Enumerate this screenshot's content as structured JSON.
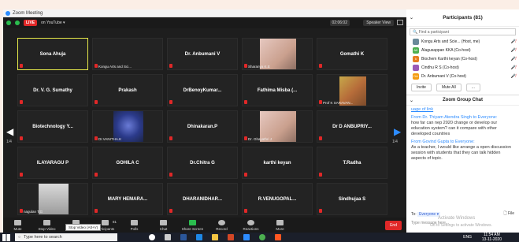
{
  "window": {
    "title": "Zoom Meeting",
    "controls": [
      "–",
      "□",
      "✕"
    ]
  },
  "topbar": {
    "live_label": "LIVE",
    "youtube_label": "on YouTube ▾",
    "timer": "02:06:02",
    "speaker_view": "Speaker View"
  },
  "tiles": [
    {
      "name": "Sona Ahuja",
      "sub": "",
      "active": true
    },
    {
      "name": "",
      "sub": "Kongu Arts and Sci..."
    },
    {
      "name": "Dr. Anbumani V",
      "sub": ""
    },
    {
      "name": "",
      "sub": "Sharanya K.E"
    },
    {
      "name": "Gomathi K",
      "sub": ""
    },
    {
      "name": "Dr. V. G. Sumathy",
      "sub": ""
    },
    {
      "name": "Prakash",
      "sub": ""
    },
    {
      "name": "DrBenoyKumar...",
      "sub": ""
    },
    {
      "name": "Fathima Misba (...",
      "sub": ""
    },
    {
      "name": "",
      "sub": "Prof K SARAVAN..."
    },
    {
      "name": "Biotechnology Y...",
      "sub": ""
    },
    {
      "name": "",
      "sub": "Dr.VANITHA.K"
    },
    {
      "name": "Dhinakaran.P",
      "sub": ""
    },
    {
      "name": "",
      "sub": "Dr. Ghayathri J"
    },
    {
      "name": "Dr D ANBUPRIY...",
      "sub": ""
    },
    {
      "name": "ILAYARAGU P",
      "sub": ""
    },
    {
      "name": "GOHILA C",
      "sub": ""
    },
    {
      "name": "Dr.Chitra G",
      "sub": ""
    },
    {
      "name": "karthi keyan",
      "sub": ""
    },
    {
      "name": "T.Radha",
      "sub": ""
    },
    {
      "name": "",
      "sub": "nagulan T.G"
    },
    {
      "name": "MARY HEMARA...",
      "sub": ""
    },
    {
      "name": "DHARANIDHAR...",
      "sub": ""
    },
    {
      "name": "R.VENUGOPAL...",
      "sub": ""
    },
    {
      "name": "Sindhujaa S",
      "sub": ""
    }
  ],
  "pager": {
    "left": "1/4",
    "right": "1/4"
  },
  "toolbar": {
    "items": [
      "Mute",
      "Stop Video",
      "Security",
      "Participants",
      "Polls",
      "Chat",
      "Share Screen",
      "Record",
      "Reactions",
      "More"
    ],
    "participants_count": "81",
    "end_label": "End",
    "tooltip": "Stop Video (Alt+V)"
  },
  "participants": {
    "title": "Participants (81)",
    "search_placeholder": "Find a participant",
    "list": [
      {
        "initials": "",
        "name": "Kongu Arts and Scie... (Host, me)",
        "color": "#6a8a9a"
      },
      {
        "initials": "AK",
        "name": "Alagusappan KKA (Co-host)",
        "color": "#4caf50"
      },
      {
        "initials": "k",
        "name": "Biochem Karthi keyan (Co-host)",
        "color": "#e67e22"
      },
      {
        "initials": "",
        "name": "Cindhu R S (Co-host)",
        "color": "#9b59b6"
      },
      {
        "initials": "DA",
        "name": "Dr. Anbumani V (Co-host)",
        "color": "#f39c12"
      }
    ],
    "invite": "Invite",
    "mute_all": "Mute All",
    "more": "..."
  },
  "chat": {
    "title": "Zoom Group Chat",
    "link_text": "uage of link",
    "messages": [
      {
        "from": "From Dr. Thiyam Atendra Singh to Everyone:",
        "text": "how far can nep 2020 change or develop our education system? can it compare with other developed countries"
      },
      {
        "from": "From Govind Gupta to Everyone:",
        "text": "As a teacher, I would like arrange a open discussion session with students that they can talk hidden aspects of topic."
      }
    ],
    "to_label": "To:",
    "to_value": "Everyone ▾",
    "file_label": "File",
    "type_placeholder": "Type message here...",
    "watermark": "Activate Windows",
    "watermark2": "Go to Settings to activate Windows."
  },
  "taskbar": {
    "search_placeholder": "Type here to search",
    "lang": "ENG",
    "time": "11:54 AM",
    "date": "13-11-2020"
  }
}
